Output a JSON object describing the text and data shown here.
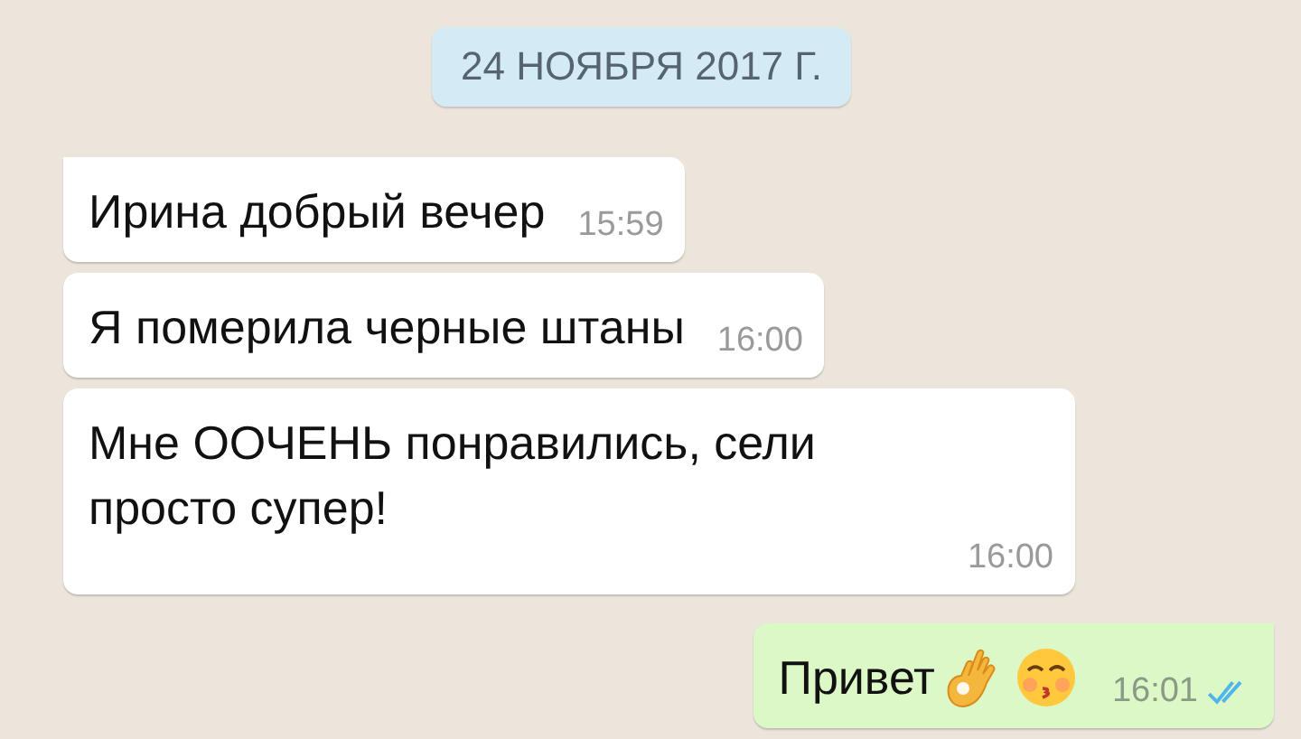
{
  "date_label": "24 НОЯБРЯ 2017 Г.",
  "messages": [
    {
      "kind": "incoming",
      "text": "Ирина добрый вечер",
      "time": "15:59",
      "tail": true
    },
    {
      "kind": "incoming",
      "text": "Я померила черные штаны",
      "time": "16:00",
      "tail": false
    },
    {
      "kind": "incoming",
      "text": "Мне ООЧЕНЬ понравились, сели просто супер!",
      "time": "16:00",
      "tail": false
    },
    {
      "kind": "outgoing",
      "text": "Привет",
      "emoji": [
        {
          "kind": "ok-hand"
        },
        {
          "kind": "kissing-face"
        }
      ],
      "time": "16:01",
      "tail": true,
      "read": true
    }
  ]
}
